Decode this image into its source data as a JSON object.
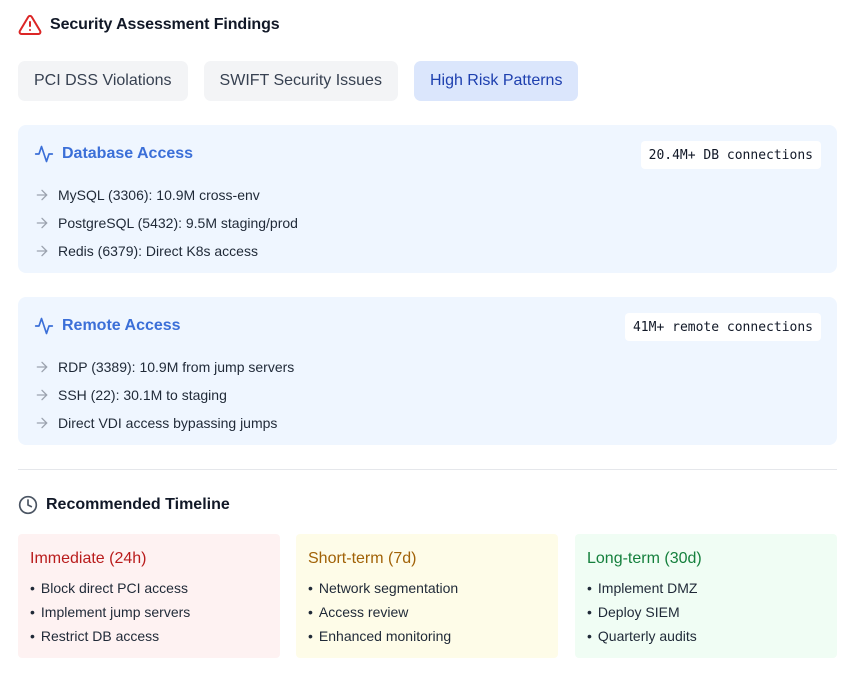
{
  "header": {
    "title": "Security Assessment Findings",
    "icon": "warning-triangle-icon",
    "icon_color": "#dc2626"
  },
  "tabs": [
    {
      "label": "PCI DSS Violations",
      "active": false
    },
    {
      "label": "SWIFT Security Issues",
      "active": false
    },
    {
      "label": "High Risk Patterns",
      "active": true
    }
  ],
  "panels": [
    {
      "title": "Database Access",
      "icon": "activity-icon",
      "badge": "20.4M+ DB connections",
      "items": [
        "MySQL (3306): 10.9M cross-env",
        "PostgreSQL (5432): 9.5M staging/prod",
        "Redis (6379): Direct K8s access"
      ]
    },
    {
      "title": "Remote Access",
      "icon": "activity-icon",
      "badge": "41M+ remote connections",
      "items": [
        "RDP (3389): 10.9M from jump servers",
        "SSH (22): 30.1M to staging",
        "Direct VDI access bypassing jumps"
      ]
    }
  ],
  "timeline": {
    "title": "Recommended Timeline",
    "icon": "clock-icon",
    "cards": [
      {
        "title": "Immediate (24h)",
        "color": "#b91c1c",
        "items": [
          "Block direct PCI access",
          "Implement jump servers",
          "Restrict DB access"
        ]
      },
      {
        "title": "Short-term (7d)",
        "color": "#a16207",
        "items": [
          "Network segmentation",
          "Access review",
          "Enhanced monitoring"
        ]
      },
      {
        "title": "Long-term (30d)",
        "color": "#15803d",
        "items": [
          "Implement DMZ",
          "Deploy SIEM",
          "Quarterly audits"
        ]
      }
    ]
  },
  "colors": {
    "accent": "#3b6fd8",
    "tab_active_bg": "#dbe6fc",
    "panel_bg": "#eff6ff"
  }
}
